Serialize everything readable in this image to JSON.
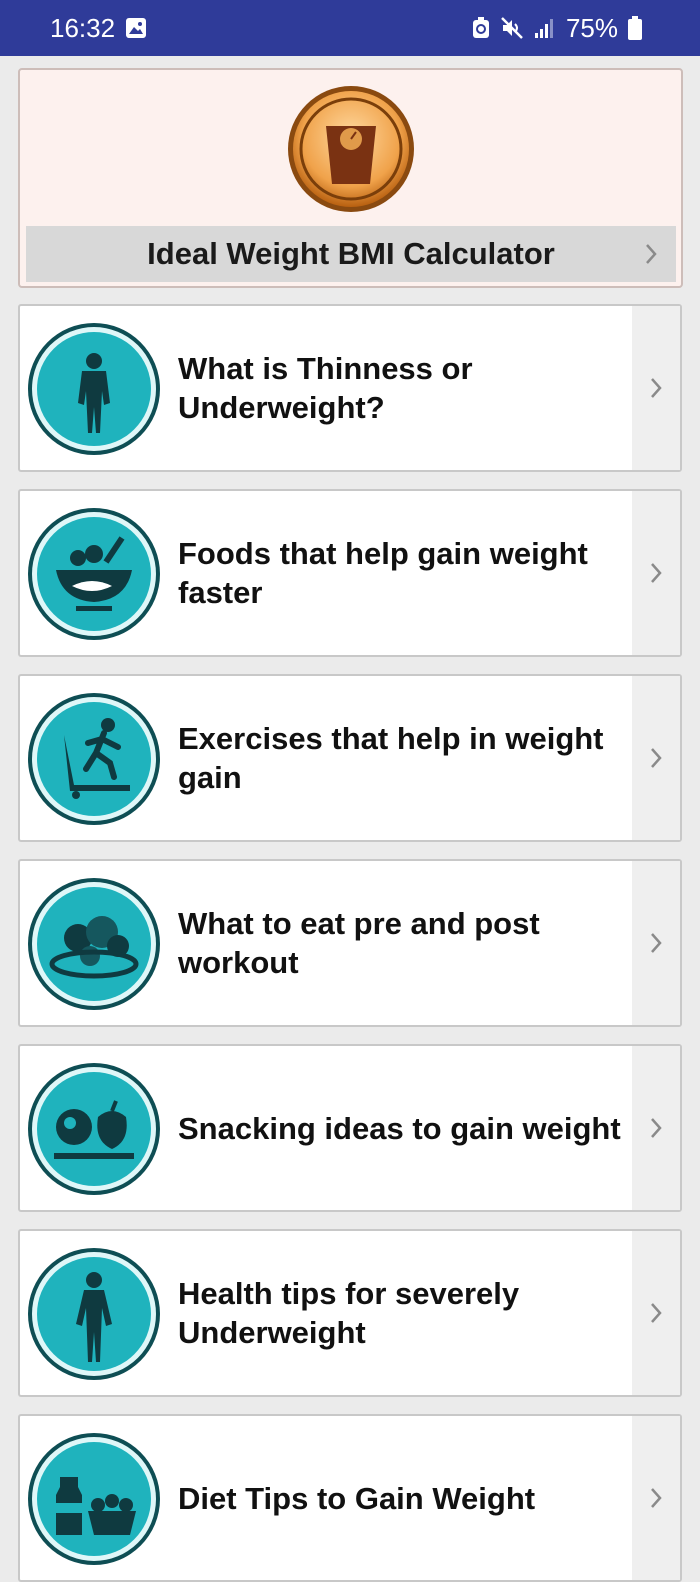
{
  "status_bar": {
    "time": "16:32",
    "battery": "75%",
    "icons": [
      "image-icon",
      "battery-saver-icon",
      "mute-icon",
      "signal-icon",
      "battery-icon"
    ]
  },
  "colors": {
    "status_bar": "#2f3b99",
    "teal": "#1fb3bd",
    "hero_bg": "#fdf1ee",
    "scale_orange": "#e8892a"
  },
  "hero": {
    "title": "Ideal Weight BMI Calculator",
    "icon": "weighing-scale-icon"
  },
  "items": [
    {
      "title": "What is Thinness or Underweight?",
      "icon": "human-body-icon"
    },
    {
      "title": "Foods that help gain weight faster",
      "icon": "food-bowl-icon"
    },
    {
      "title": "Exercises that help in weight gain",
      "icon": "treadmill-icon"
    },
    {
      "title": "What to eat pre and post workout",
      "icon": "fruit-plate-icon"
    },
    {
      "title": "Snacking ideas to gain weight",
      "icon": "snacks-icon"
    },
    {
      "title": "Health tips for severely Underweight",
      "icon": "human-figure-icon"
    },
    {
      "title": "Diet Tips to Gain Weight",
      "icon": "groceries-icon"
    }
  ]
}
